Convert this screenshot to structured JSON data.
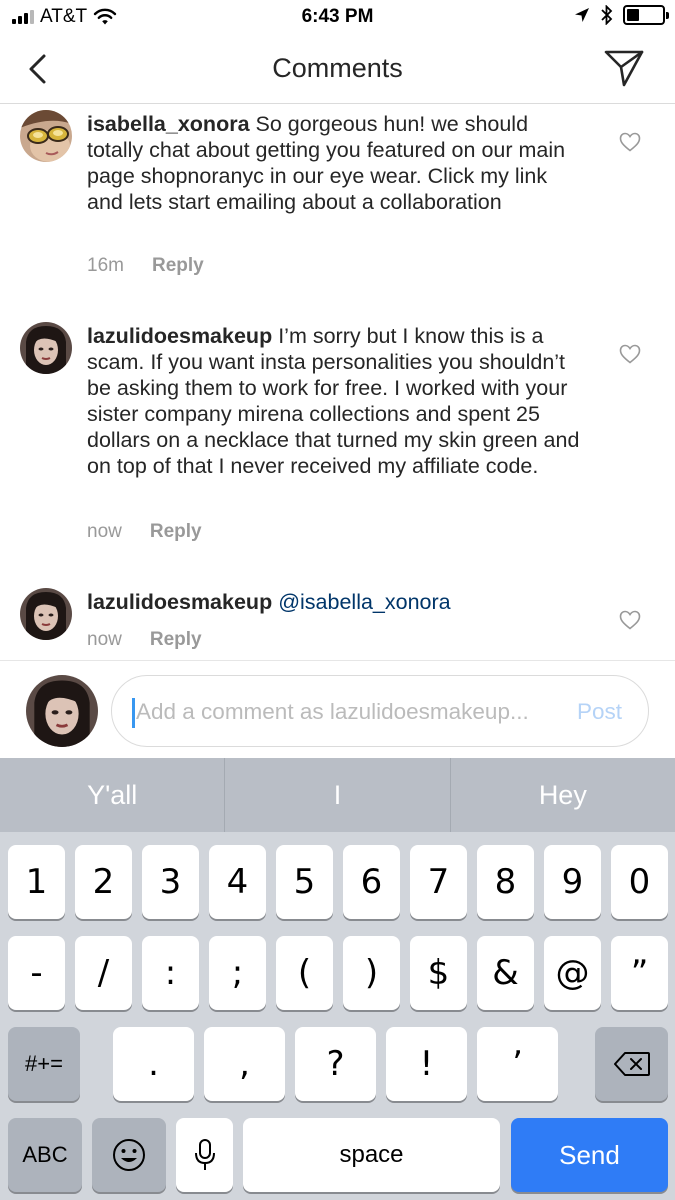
{
  "status_bar": {
    "carrier": "AT&T",
    "time": "6:43 PM"
  },
  "header": {
    "title": "Comments"
  },
  "comments": [
    {
      "username": "isabella_xonora",
      "text": "So gorgeous hun! we should totally chat about getting you featured on our main page shopnoranyc  in our eye wear. Click my link and lets start emailing about a collaboration",
      "time": "16m",
      "reply_label": "Reply"
    },
    {
      "username": "lazulidoesmakeup",
      "text": "I’m sorry but I know this is a scam. If you want insta personalities you shouldn’t be asking them to work for free. I worked with your sister company mirena collections and spent 25 dollars on a necklace that turned my skin green and on top of that I never received my affiliate code.",
      "time": "now",
      "reply_label": "Reply"
    },
    {
      "username": "lazulidoesmakeup",
      "mention": "@isabella_xonora",
      "time": "now",
      "reply_label": "Reply"
    }
  ],
  "composer": {
    "placeholder": "Add a comment as lazulidoesmakeup...",
    "post_label": "Post"
  },
  "keyboard": {
    "suggestions": [
      "Y'all",
      "I",
      "Hey"
    ],
    "row1": [
      "1",
      "2",
      "3",
      "4",
      "5",
      "6",
      "7",
      "8",
      "9",
      "0"
    ],
    "row2": [
      "-",
      "/",
      ":",
      ";",
      "(",
      ")",
      "$",
      "&",
      "@",
      "”"
    ],
    "row3_toggle": "#+=",
    "row3": [
      ".",
      ",",
      "?",
      "!",
      "’"
    ],
    "abc_label": "ABC",
    "space_label": "space",
    "send_label": "Send"
  },
  "colors": {
    "accent": "#3897f0",
    "send_key": "#2f7cf6",
    "mention": "#003569"
  },
  "icons": [
    "back-chevron-icon",
    "direct-send-icon",
    "heart-icon",
    "delete-key-icon",
    "emoji-icon",
    "microphone-icon",
    "wifi-icon",
    "location-icon",
    "bluetooth-icon",
    "battery-icon"
  ]
}
